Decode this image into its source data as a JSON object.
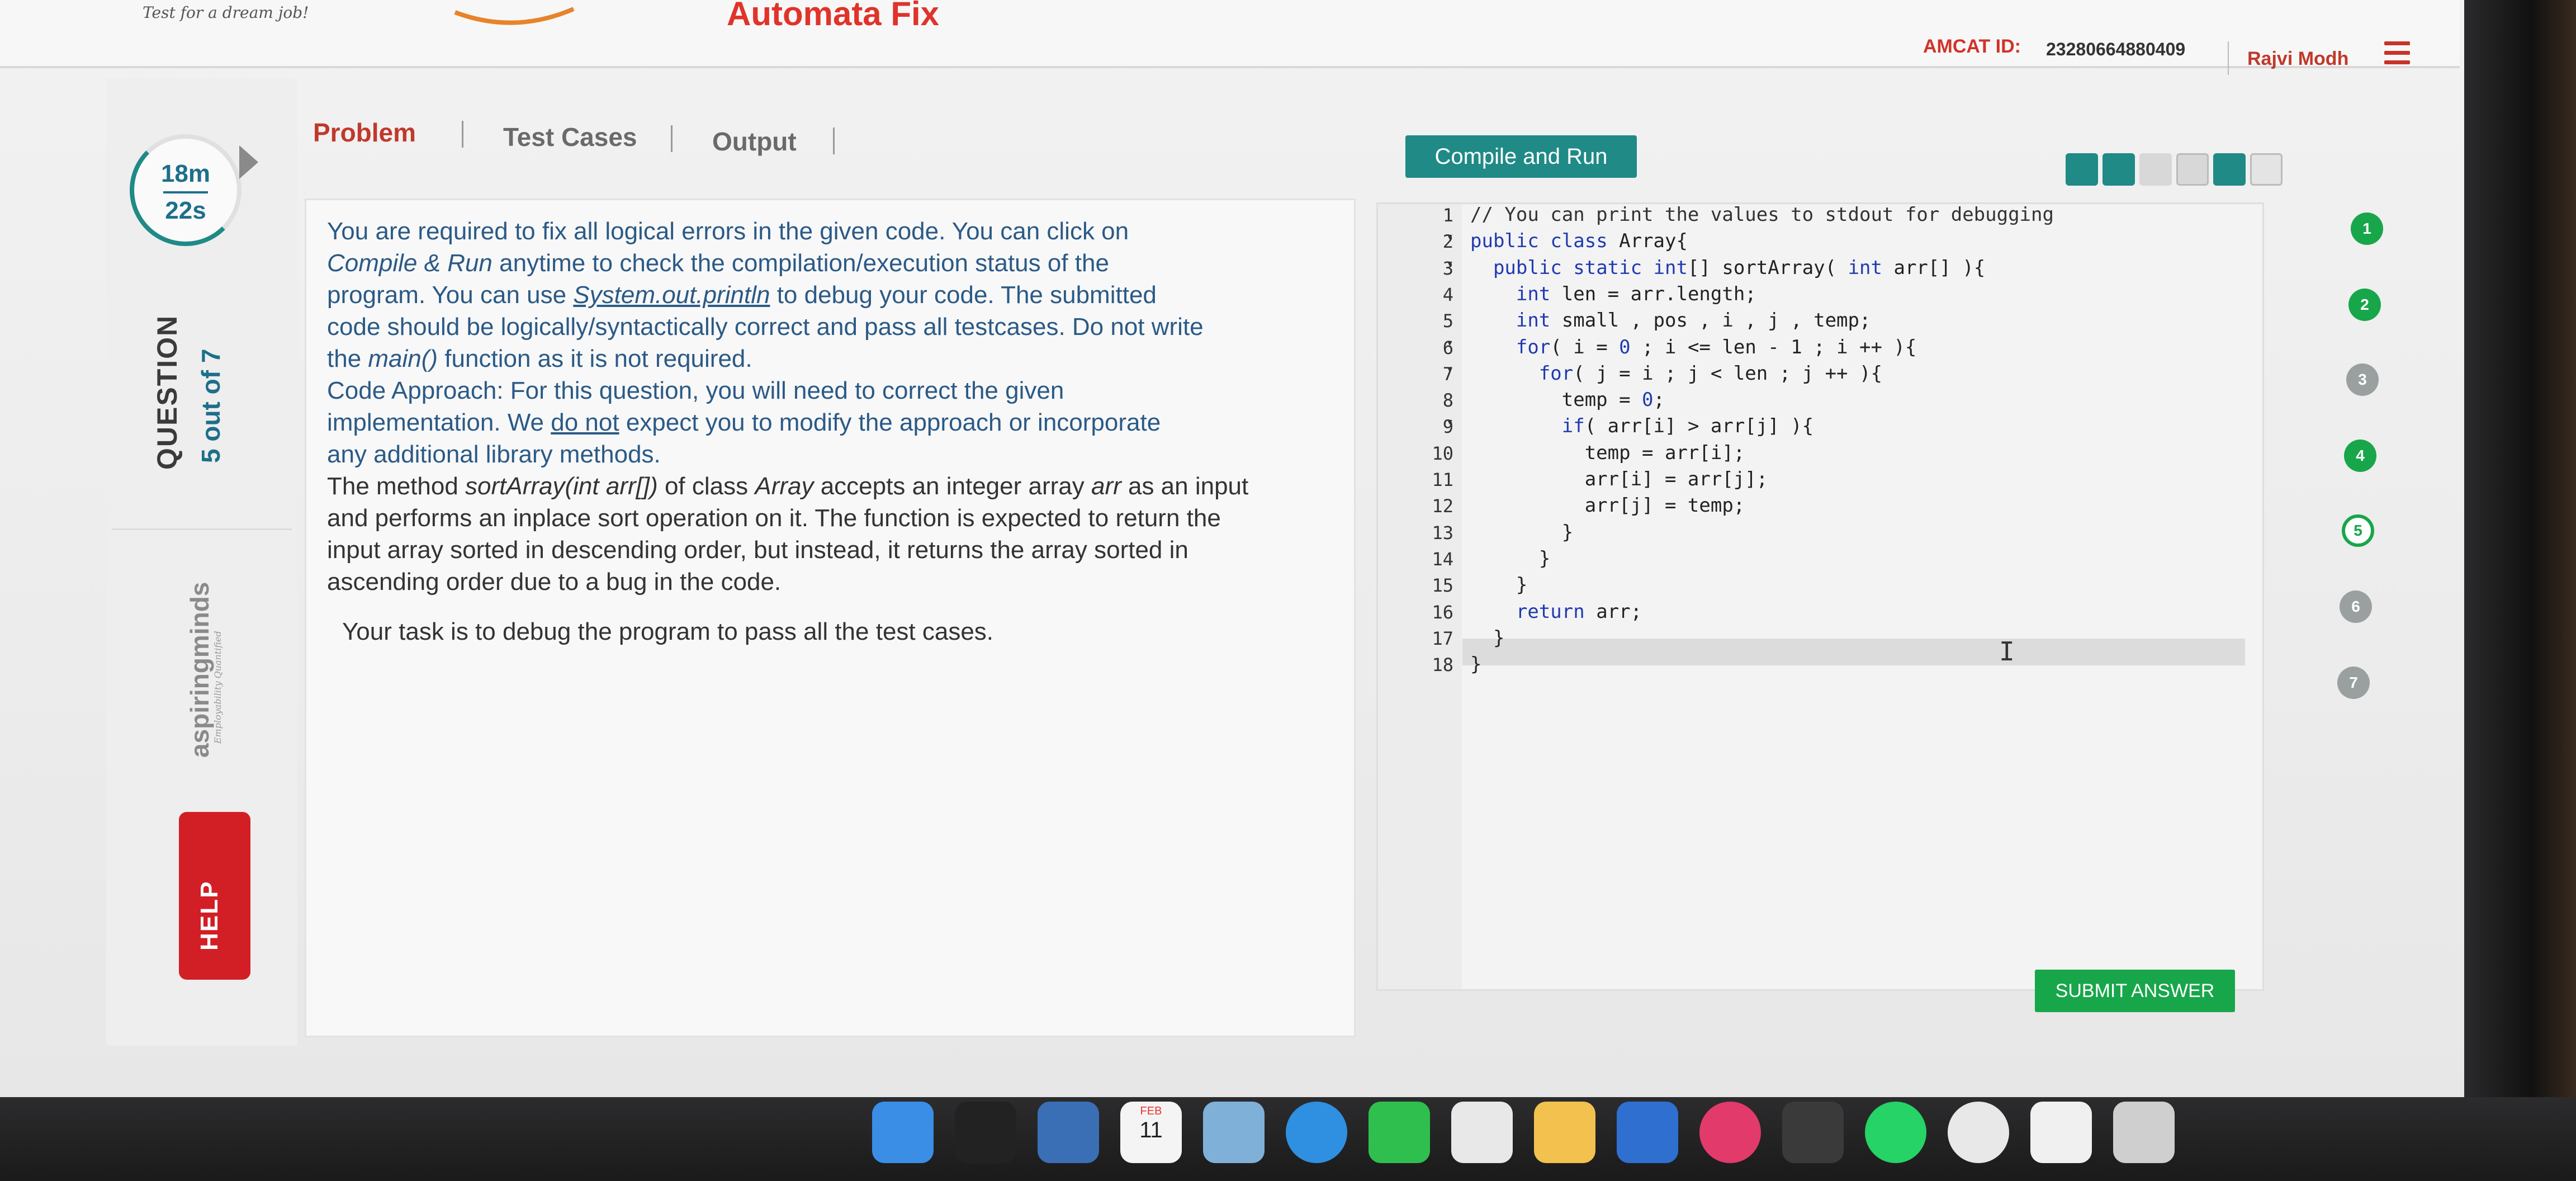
{
  "header": {
    "tagline": "Test for a dream job!",
    "app_title": "Automata Fix",
    "amcat_label": "AMCAT ID:",
    "amcat_id": "23280664880409",
    "user_name": "Rajvi Modh",
    "menu_icon": "hamburger-menu-icon"
  },
  "sidebar": {
    "timer_minutes": "18m",
    "timer_seconds": "22s",
    "question_label": "QUESTION",
    "question_count": "5 out of 7",
    "brand": "aspiringminds",
    "brand_sub": "Employability Quantified",
    "help_label": "HELP"
  },
  "tabs": {
    "problem": "Problem",
    "test_cases": "Test Cases",
    "output": "Output"
  },
  "problem": {
    "p1_a": "You are required to fix all logical errors in the given code. You can click on",
    "p1_b_em": "Compile & Run",
    "p1_b": " anytime to check the compilation/execution status of the",
    "p1_c_a": "program. You can use ",
    "p1_c_em": "System.out.println",
    "p1_c_b": " to debug your code. The submitted",
    "p1_d": "code should be logically/syntactically correct and pass all testcases. Do not write",
    "p1_e_a": "the ",
    "p1_e_em": "main()",
    "p1_e_b": " function as it is not required.",
    "p2_a": "Code Approach: For this question, you will need to correct the given",
    "p2_b_a": "implementation. We ",
    "p2_b_ul": "do not",
    "p2_b_b": " expect you to modify the approach or incorporate",
    "p2_c": "any additional library methods.",
    "p3_a": "The method ",
    "p3_a_em": "sortArray(int arr[])",
    "p3_a_b": " of class ",
    "p3_a_em2": "Array",
    "p3_a_c": " accepts an integer array ",
    "p3_a_em3": "arr",
    "p3_a_d": " as an input",
    "p3_b": "and performs an inplace sort operation on it. The function is expected to return the",
    "p3_c": "input array sorted in descending order, but instead, it returns the array sorted in",
    "p3_d": "ascending order due to a bug in the code.",
    "task": "Your task is to debug the program to pass all the test cases."
  },
  "editor": {
    "compile_label": "Compile and Run",
    "toolbar_icons": [
      "reset-icon",
      "save-icon",
      "settings-icon",
      "layout-icon",
      "fullscreen-icon",
      "split-icon"
    ],
    "lines": [
      {
        "n": "1",
        "fold": "",
        "code": "// You can print the values to stdout for debugging"
      },
      {
        "n": "2",
        "fold": "▾",
        "code": "public class Array{"
      },
      {
        "n": "3",
        "fold": "▾",
        "code": "  public static int[] sortArray( int arr[] ){"
      },
      {
        "n": "4",
        "fold": "",
        "code": "    int len = arr.length;"
      },
      {
        "n": "5",
        "fold": "",
        "code": "    int small , pos , i , j , temp;"
      },
      {
        "n": "6",
        "fold": "▾",
        "code": "    for( i = 0 ; i <= len - 1 ; i ++ ){"
      },
      {
        "n": "7",
        "fold": "▾",
        "code": "      for( j = i ; j < len ; j ++ ){"
      },
      {
        "n": "8",
        "fold": "",
        "code": "        temp = 0;"
      },
      {
        "n": "9",
        "fold": "▾",
        "code": "        if( arr[i] > arr[j] ){"
      },
      {
        "n": "10",
        "fold": "",
        "code": "          temp = arr[i];"
      },
      {
        "n": "11",
        "fold": "",
        "code": "          arr[i] = arr[j];"
      },
      {
        "n": "12",
        "fold": "",
        "code": "          arr[j] = temp;"
      },
      {
        "n": "13",
        "fold": "",
        "code": "        }"
      },
      {
        "n": "14",
        "fold": "",
        "code": "      }"
      },
      {
        "n": "15",
        "fold": "",
        "code": "    }"
      },
      {
        "n": "16",
        "fold": "",
        "code": "    return arr;"
      },
      {
        "n": "17",
        "fold": "",
        "code": "  }"
      },
      {
        "n": "18",
        "fold": "",
        "code": "}"
      }
    ],
    "submit_label": "SUBMIT ANSWER"
  },
  "question_nav": [
    {
      "label": "1",
      "state": "answered"
    },
    {
      "label": "2",
      "state": "answered"
    },
    {
      "label": "3",
      "state": "not-visited"
    },
    {
      "label": "4",
      "state": "answered"
    },
    {
      "label": "5",
      "state": "current"
    },
    {
      "label": "6",
      "state": "not-visited"
    },
    {
      "label": "7",
      "state": "not-visited"
    }
  ],
  "colors": {
    "accent_red": "#c0392b",
    "accent_teal": "#1f8a86",
    "text_blue": "#2b5a86",
    "answered_green": "#18a64a",
    "unvisited_gray": "#9aa0a0"
  },
  "dock": {
    "calendar_month": "FEB",
    "calendar_day": "11",
    "apps": [
      "finder-icon",
      "terminal-icon",
      "preview-icon",
      "calendar-icon",
      "photos-icon",
      "safari-icon",
      "facetime-icon",
      "textedit-icon",
      "notes-icon",
      "keynote-icon",
      "music-icon",
      "sublime-icon",
      "whatsapp-icon",
      "chrome-icon",
      "documents-icon",
      "trash-icon"
    ]
  }
}
